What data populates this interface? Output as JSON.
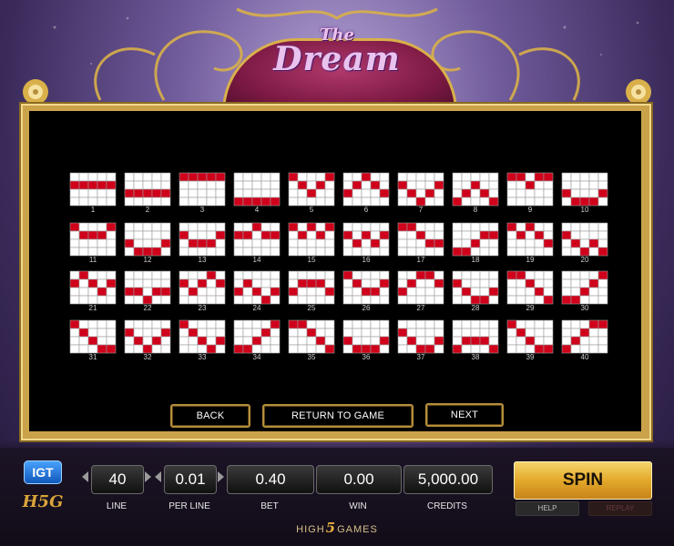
{
  "game": {
    "title_small": "The",
    "title_big": "Dream"
  },
  "paylines": [
    {
      "num": "1",
      "rows": [
        1,
        1,
        1,
        1,
        1
      ]
    },
    {
      "num": "2",
      "rows": [
        2,
        2,
        2,
        2,
        2
      ]
    },
    {
      "num": "3",
      "rows": [
        0,
        0,
        0,
        0,
        0
      ]
    },
    {
      "num": "4",
      "rows": [
        3,
        3,
        3,
        3,
        3
      ]
    },
    {
      "num": "5",
      "rows": [
        0,
        1,
        2,
        1,
        0
      ]
    },
    {
      "num": "6",
      "rows": [
        2,
        1,
        0,
        1,
        2
      ]
    },
    {
      "num": "7",
      "rows": [
        1,
        2,
        3,
        2,
        1
      ]
    },
    {
      "num": "8",
      "rows": [
        3,
        2,
        1,
        2,
        3
      ]
    },
    {
      "num": "9",
      "rows": [
        0,
        0,
        1,
        0,
        0
      ]
    },
    {
      "num": "10",
      "rows": [
        2,
        3,
        3,
        3,
        2
      ]
    },
    {
      "num": "11",
      "rows": [
        0,
        1,
        1,
        1,
        0
      ]
    },
    {
      "num": "12",
      "rows": [
        2,
        3,
        3,
        3,
        2
      ]
    },
    {
      "num": "13",
      "rows": [
        1,
        2,
        2,
        2,
        1
      ]
    },
    {
      "num": "14",
      "rows": [
        1,
        1,
        0,
        1,
        1
      ]
    },
    {
      "num": "15",
      "rows": [
        0,
        1,
        0,
        1,
        0
      ]
    },
    {
      "num": "16",
      "rows": [
        1,
        2,
        1,
        2,
        1
      ]
    },
    {
      "num": "17",
      "rows": [
        0,
        0,
        1,
        2,
        2
      ]
    },
    {
      "num": "18",
      "rows": [
        3,
        3,
        2,
        1,
        1
      ]
    },
    {
      "num": "19",
      "rows": [
        0,
        1,
        0,
        1,
        2
      ]
    },
    {
      "num": "20",
      "rows": [
        1,
        2,
        3,
        2,
        3
      ]
    },
    {
      "num": "21",
      "rows": [
        1,
        0,
        1,
        2,
        1
      ]
    },
    {
      "num": "22",
      "rows": [
        2,
        2,
        3,
        2,
        2
      ]
    },
    {
      "num": "23",
      "rows": [
        1,
        2,
        1,
        0,
        1
      ]
    },
    {
      "num": "24",
      "rows": [
        2,
        1,
        2,
        3,
        2
      ]
    },
    {
      "num": "25",
      "rows": [
        2,
        1,
        1,
        1,
        2
      ]
    },
    {
      "num": "26",
      "rows": [
        0,
        1,
        2,
        2,
        1
      ]
    },
    {
      "num": "27",
      "rows": [
        2,
        1,
        0,
        0,
        1
      ]
    },
    {
      "num": "28",
      "rows": [
        1,
        2,
        3,
        3,
        2
      ]
    },
    {
      "num": "29",
      "rows": [
        0,
        0,
        1,
        2,
        3
      ]
    },
    {
      "num": "30",
      "rows": [
        3,
        3,
        2,
        1,
        0
      ]
    },
    {
      "num": "31",
      "rows": [
        0,
        1,
        2,
        3,
        3
      ]
    },
    {
      "num": "32",
      "rows": [
        1,
        2,
        3,
        2,
        1
      ]
    },
    {
      "num": "33",
      "rows": [
        0,
        1,
        2,
        3,
        2
      ]
    },
    {
      "num": "34",
      "rows": [
        3,
        3,
        2,
        1,
        0
      ]
    },
    {
      "num": "35",
      "rows": [
        0,
        0,
        1,
        2,
        3
      ]
    },
    {
      "num": "36",
      "rows": [
        2,
        3,
        3,
        3,
        2
      ]
    },
    {
      "num": "37",
      "rows": [
        1,
        2,
        3,
        3,
        2
      ]
    },
    {
      "num": "38",
      "rows": [
        3,
        2,
        2,
        2,
        3
      ]
    },
    {
      "num": "39",
      "rows": [
        0,
        1,
        2,
        3,
        3
      ]
    },
    {
      "num": "40",
      "rows": [
        3,
        2,
        1,
        0,
        0
      ]
    }
  ],
  "nav": {
    "back": "BACK",
    "return": "RETURN TO GAME",
    "next": "NEXT"
  },
  "hud": {
    "line_value": "40",
    "line_label": "LINE",
    "per_line_value": "0.01",
    "per_line_label": "PER LINE",
    "bet_value": "0.40",
    "bet_label": "BET",
    "win_value": "0.00",
    "win_label": "WIN",
    "credits_value": "5,000.00",
    "credits_label": "CREDITS"
  },
  "buttons": {
    "spin": "SPIN",
    "help": "HELP",
    "replay": "REPLAY"
  },
  "branding": {
    "igt": "IGT",
    "h5g": "H5G",
    "footer_left": "HIGH",
    "footer_five": "5",
    "footer_right": "GAMES"
  },
  "colors": {
    "payline_red": "#d0021b",
    "gold": "#caa24a",
    "panel": "#000000"
  }
}
